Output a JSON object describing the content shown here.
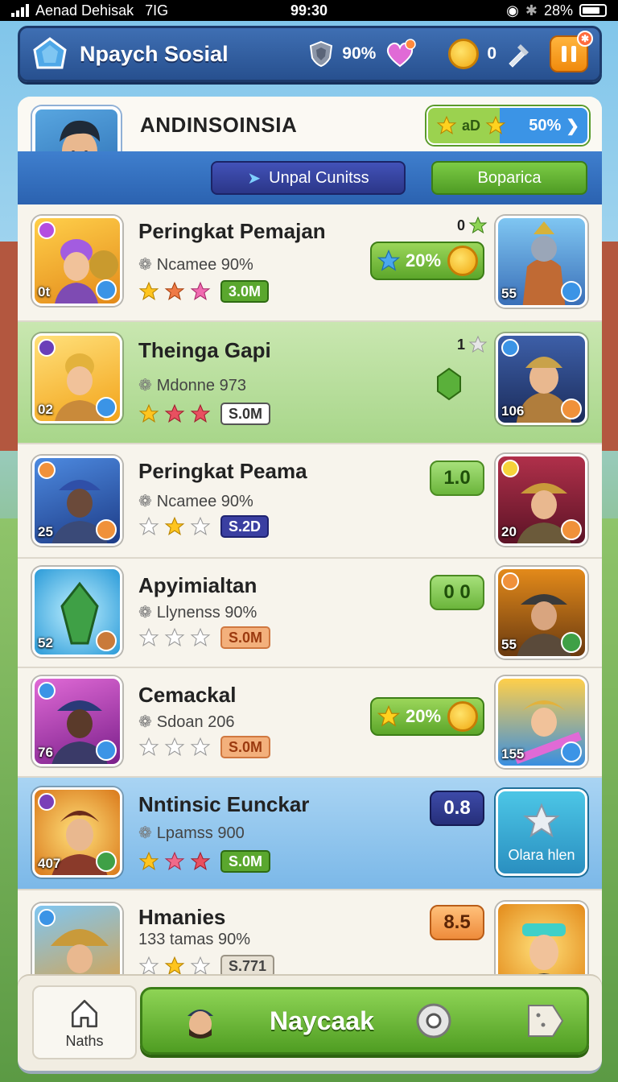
{
  "status_bar": {
    "carrier": "Aenad Dehisak",
    "network": "7IG",
    "time": "99:30",
    "battery": "28%"
  },
  "header": {
    "title": "Npaych Sosial",
    "shield_value": "90%",
    "coin_value": "0"
  },
  "profile": {
    "name": "ANDINSOINSIA",
    "rating_label": "aD",
    "rating_percent": "50%",
    "update_button": "Unpal Cunitss",
    "secondary_button": "Boparica"
  },
  "rows": [
    {
      "title": "Peringkat Pemajan",
      "subtitle": "Ncamee 90%",
      "stars": 3,
      "chip": "3.0M",
      "thumb_count": "0t",
      "rank": "0",
      "reward": "20%",
      "side_count": "55"
    },
    {
      "title": "Theinga Gapi",
      "subtitle": "Mdonne 973",
      "stars": 3,
      "chip": "S.0M",
      "thumb_count": "02",
      "rank": "1",
      "side_count": "106"
    },
    {
      "title": "Peringkat Peama",
      "subtitle": "Ncamee 90%",
      "stars": 1,
      "chip": "S.2D",
      "thumb_count": "25",
      "score": "1.0",
      "side_count": "20"
    },
    {
      "title": "Apyimialtan",
      "subtitle": "Llynenss 90%",
      "stars": 0,
      "chip": "S.0M",
      "thumb_count": "52",
      "score": "0 0",
      "side_count": "55"
    },
    {
      "title": "Cemackal",
      "subtitle": "Sdoan 206",
      "stars": 0,
      "chip": "S.0M",
      "thumb_count": "76",
      "reward": "20%",
      "side_count": "155"
    },
    {
      "title": "Nntinsic Eunckar",
      "subtitle": "Lpamss 900",
      "stars": 3,
      "chip": "S.0M",
      "thumb_count": "407",
      "score": "0.8",
      "side_button": "Olara hlen"
    },
    {
      "title": "Hmanies",
      "subtitle": "133 tamas 90%",
      "stars": 1,
      "chip": "S.771",
      "score": "8.5"
    }
  ],
  "bottom_nav": {
    "home_label": "Naths",
    "play_label": "Naycaak"
  },
  "colors": {
    "primary_blue": "#2b62b0",
    "accent_green": "#5ca62a",
    "gold": "#f0a70f"
  }
}
